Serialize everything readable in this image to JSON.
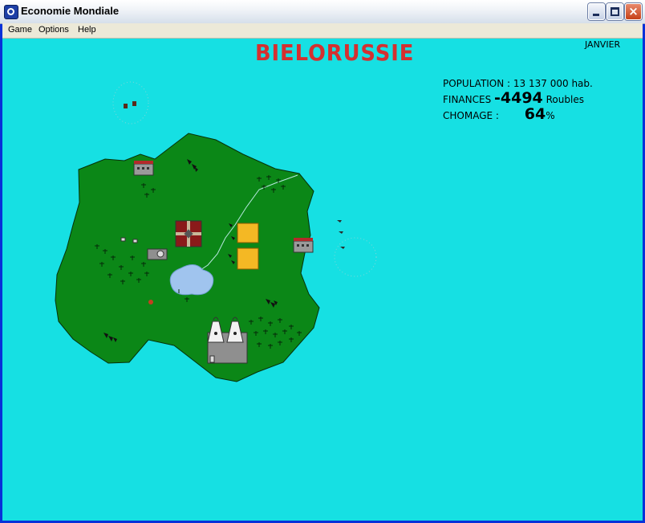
{
  "window": {
    "title": "Economie Mondiale",
    "close_glyph": "×"
  },
  "menu": [
    {
      "label": "Game"
    },
    {
      "label": "Options"
    },
    {
      "label": "Help"
    }
  ],
  "game": {
    "country": "BIELORUSSIE",
    "month": "JANVIER",
    "population_label": "POPULATION :",
    "population_value": "13 137 000 hab.",
    "finances_label": "FINANCES",
    "finances_value": "-4494",
    "finances_unit": "Roubles",
    "chomage_label": "CHOMAGE :",
    "chomage_value": "64",
    "chomage_unit": "%"
  },
  "colors": {
    "sea": "#16e0e3",
    "land": "#0b8717",
    "country_title": "#d43030",
    "lake": "#a0c4ee",
    "fields": "#f4b824"
  },
  "icons": [
    "app-icon",
    "minimize-icon",
    "maximize-icon",
    "close-icon"
  ]
}
